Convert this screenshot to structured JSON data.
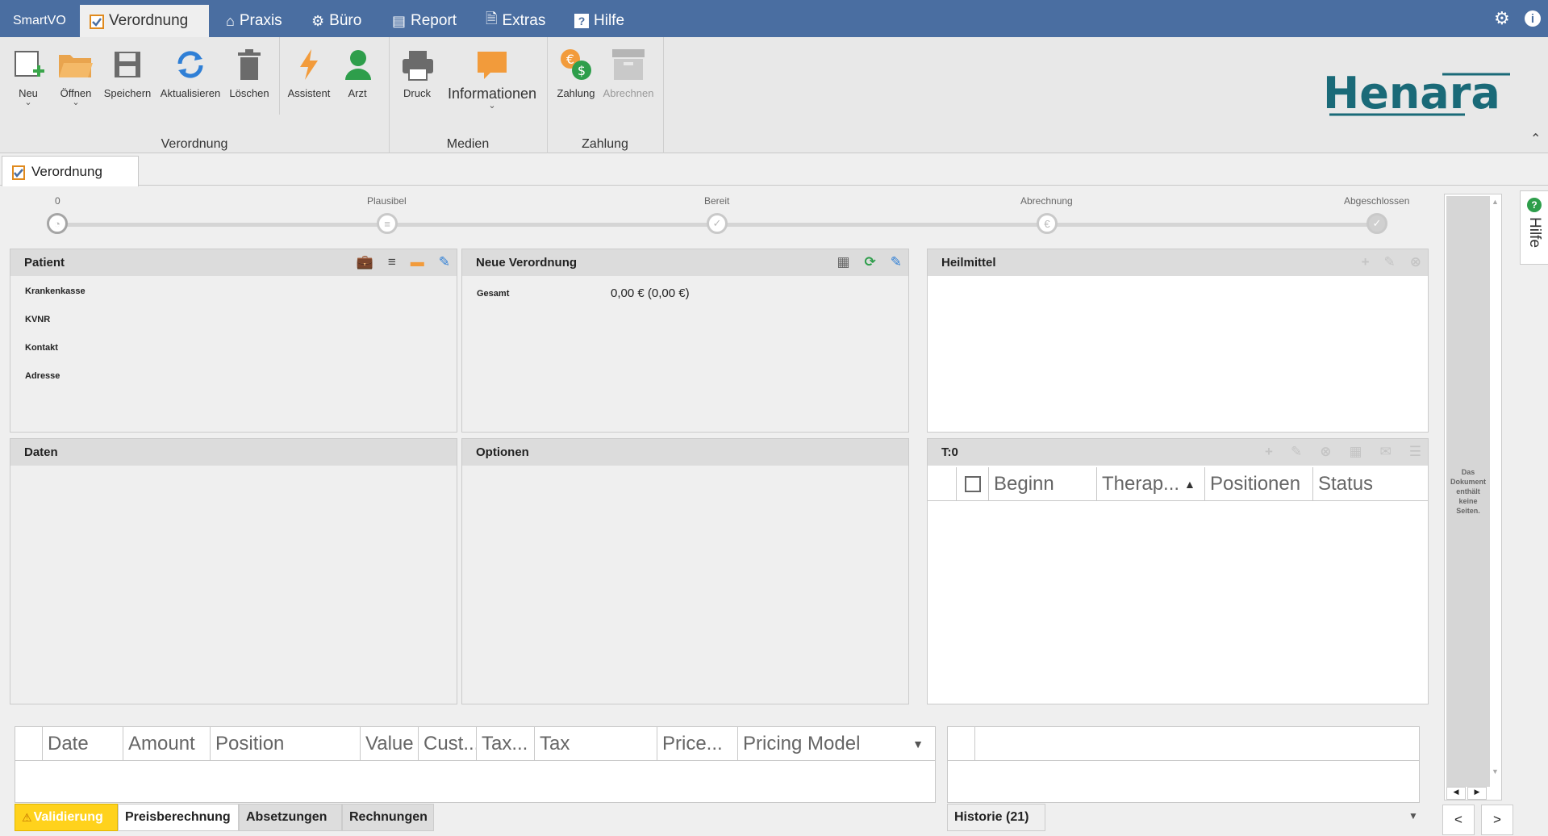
{
  "menubar": {
    "app_title": "SmartVO",
    "tabs": [
      {
        "label": "Verordnung",
        "icon": "clipboard-check-icon"
      },
      {
        "label": "Praxis",
        "icon": "home-icon"
      },
      {
        "label": "Büro",
        "icon": "gears-icon"
      },
      {
        "label": "Report",
        "icon": "report-icon"
      },
      {
        "label": "Extras",
        "icon": "document-search-icon"
      },
      {
        "label": "Hilfe",
        "icon": "question-icon"
      }
    ],
    "active_tab": "Verordnung"
  },
  "ribbon": {
    "buttons": {
      "neu": "Neu",
      "oeffnen": "Öffnen",
      "speichern": "Speichern",
      "aktualisieren": "Aktualisieren",
      "loeschen": "Löschen",
      "assistent": "Assistent",
      "arzt": "Arzt",
      "druck": "Druck",
      "informationen": "Informationen",
      "zahlung": "Zahlung",
      "abrechnen": "Abrechnen"
    },
    "groups": {
      "verordnung": "Verordnung",
      "medien": "Medien",
      "zahlung": "Zahlung"
    },
    "logo": "Henara"
  },
  "doc_tab": {
    "label": "Verordnung"
  },
  "progress": {
    "steps": [
      "0",
      "Plausibel",
      "Bereit",
      "Abrechnung",
      "Abgeschlossen"
    ],
    "current_step": 0
  },
  "patient": {
    "title": "Patient",
    "fields": {
      "krankenkasse": "Krankenkasse",
      "kvnr": "KVNR",
      "kontakt": "Kontakt",
      "adresse": "Adresse"
    }
  },
  "neue_verordnung": {
    "title": "Neue Verordnung",
    "gesamt_label": "Gesamt",
    "gesamt_value": "0,00 € (0,00 €)"
  },
  "heilmittel": {
    "title": "Heilmittel"
  },
  "daten": {
    "title": "Daten"
  },
  "optionen": {
    "title": "Optionen"
  },
  "termine": {
    "title": "T:0",
    "columns": [
      "Beginn",
      "Therap...",
      "Positionen",
      "Status"
    ]
  },
  "pricing_grid": {
    "columns": [
      "Date",
      "Amount",
      "Position",
      "Value",
      "Cust...",
      "Tax...",
      "Tax",
      "Price...",
      "Pricing Model"
    ]
  },
  "bottom_tabs": [
    "Validierung",
    "Preisberechnung",
    "Absetzungen",
    "Rechnungen"
  ],
  "historie": {
    "label": "Historie (21)"
  },
  "document_viewer": {
    "empty_text": "Das Dokument enthält keine Seiten."
  },
  "side_panel": {
    "label": "Hilfe"
  },
  "nav": {
    "prev": "<",
    "next": ">"
  },
  "colors": {
    "menubar": "#4a6ea1",
    "accent_orange": "#f29b3b",
    "warning_yellow": "#ffd21c",
    "brand_teal": "#1a6a78"
  }
}
